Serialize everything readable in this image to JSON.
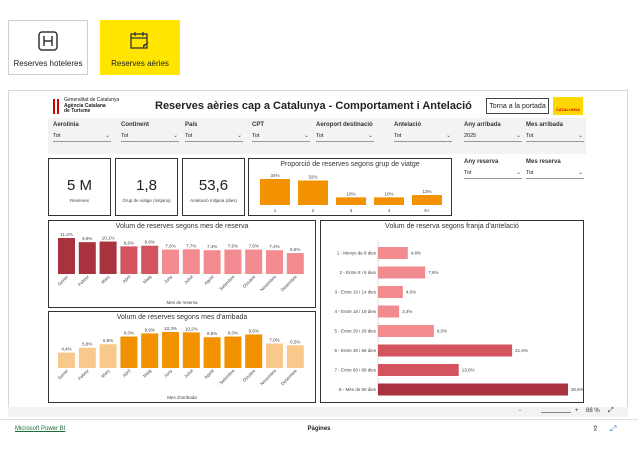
{
  "nav": {
    "hotels_label": "Reserves hoteleres",
    "air_label": "Reserves aèries"
  },
  "header": {
    "title": "Reserves aèries cap a Catalunya - Comportament i Antelació",
    "logo_lines": [
      "Generalitat de Catalunya",
      "Agència Catalana",
      "de Turisme"
    ],
    "home_label": "Torna a la portada",
    "brand": "CATALUNYA"
  },
  "filters": [
    {
      "label": "Aerolínia",
      "value": "Tot"
    },
    {
      "label": "Continent",
      "value": "Tot"
    },
    {
      "label": "País",
      "value": "Tot"
    },
    {
      "label": "CPT",
      "value": "Tot"
    },
    {
      "label": "Aeroport destinació",
      "value": "Tot"
    },
    {
      "label": "Antelació",
      "value": "Tot"
    },
    {
      "label": "Any arribada",
      "value": "2025"
    },
    {
      "label": "Mes arribada",
      "value": "Tot"
    },
    {
      "label": "Any reserva",
      "value": "Tot"
    },
    {
      "label": "Mes reserva",
      "value": "Tot"
    }
  ],
  "kpis": [
    {
      "value": "5 M",
      "caption": "Reserves"
    },
    {
      "value": "1,8",
      "caption": "Grup de viatge (mitjana)"
    },
    {
      "value": "53,6",
      "caption": "Antelació mitjana (dies)"
    }
  ],
  "colors": {
    "dark_red": "#a8323e",
    "mid_red": "#d3545f",
    "pink": "#f28b90",
    "orange": "#f39200",
    "light_orange": "#f9c98c",
    "yellow": "#ffe500"
  },
  "chart_data": [
    {
      "type": "bar",
      "title": "Proporció de reserves segons grup de viatge",
      "categories": [
        "1",
        "2",
        "3",
        "4",
        "5+"
      ],
      "values": [
        34,
        32,
        10,
        10,
        13
      ],
      "labels": [
        "34%",
        "32%",
        "10%",
        "10%",
        "13%"
      ]
    },
    {
      "type": "bar",
      "title": "Volum de reserves segons mes de reserva",
      "xlabel": "Mes de reserva",
      "categories": [
        "Gener",
        "Febrer",
        "Març",
        "Abril",
        "Maig",
        "Juny",
        "Juliol",
        "Agost",
        "Setembre",
        "Octubre",
        "Novembre",
        "Desembre"
      ],
      "values": [
        11.2,
        9.9,
        10.1,
        8.6,
        8.8,
        7.6,
        7.7,
        7.4,
        7.6,
        7.6,
        7.4,
        6.5
      ],
      "labels": [
        "11,2%",
        "9,9%",
        "10,1%",
        "8,6%",
        "8,8%",
        "7,6%",
        "7,7%",
        "7,4%",
        "7,6%",
        "7,6%",
        "7,4%",
        "6,5%"
      ]
    },
    {
      "type": "bar",
      "title": "Volum de reserves segons mes d'arribada",
      "xlabel": "Mes d'arribada",
      "categories": [
        "Gener",
        "Febrer",
        "Març",
        "Abril",
        "Maig",
        "Juny",
        "Juliol",
        "Agost",
        "Setembre",
        "Octubre",
        "Novembre",
        "Desembre"
      ],
      "values": [
        4.4,
        5.8,
        6.8,
        9.0,
        9.9,
        10.3,
        10.2,
        8.8,
        9.0,
        9.6,
        7.0,
        6.5
      ],
      "labels": [
        "4,4%",
        "5,8%",
        "6,8%",
        "9,0%",
        "9,9%",
        "10,3%",
        "10,2%",
        "8,8%",
        "9,0%",
        "9,6%",
        "7,0%",
        "6,5%"
      ]
    },
    {
      "type": "bar",
      "title": "Volum de reserva segons franja d'antelació",
      "categories": [
        "1 - Menys de 8 dies",
        "2 - Entre 8 i 9 dies",
        "3 - Entre 10 i 14 dies",
        "4 - Entre 16 i 19 dies",
        "5 - Entre 20 i 29 dies",
        "6 - Entre 30 i 59 dies",
        "7 - Entre 60 i 89 dies",
        "8 - Més de 90 dies"
      ],
      "values": [
        4.8,
        7.6,
        4.0,
        3.4,
        9.0,
        21.6,
        13.0,
        30.6
      ],
      "labels": [
        "4,8%",
        "7,6%",
        "4,0%",
        "3,4%",
        "9,0%",
        "21,6%",
        "13,0%",
        "30,6%"
      ]
    }
  ],
  "bottom": {
    "minus": "-",
    "plus": "+",
    "zoom": "88 %"
  },
  "footer": {
    "powerbi": "Microsoft Power BI",
    "pages": "Pàgines"
  }
}
